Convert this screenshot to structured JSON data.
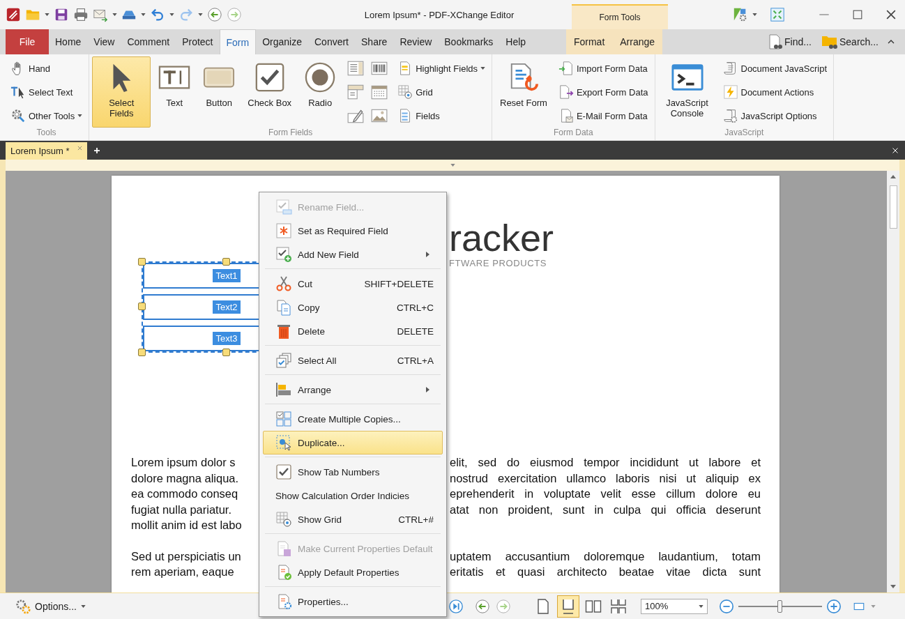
{
  "title_bar": {
    "title": "Lorem Ipsum* - PDF-XChange Editor",
    "context_group": "Form Tools"
  },
  "menu_tabs": [
    {
      "label": "File",
      "kind": "file",
      "selected": false
    },
    {
      "label": "Home",
      "kind": "tab",
      "selected": false
    },
    {
      "label": "View",
      "kind": "tab",
      "selected": false
    },
    {
      "label": "Comment",
      "kind": "tab",
      "selected": false
    },
    {
      "label": "Protect",
      "kind": "tab",
      "selected": false
    },
    {
      "label": "Form",
      "kind": "tab",
      "selected": true
    },
    {
      "label": "Organize",
      "kind": "tab",
      "selected": false
    },
    {
      "label": "Convert",
      "kind": "tab",
      "selected": false
    },
    {
      "label": "Share",
      "kind": "tab",
      "selected": false
    },
    {
      "label": "Review",
      "kind": "tab",
      "selected": false
    },
    {
      "label": "Bookmarks",
      "kind": "tab",
      "selected": false
    },
    {
      "label": "Help",
      "kind": "tab",
      "selected": false
    },
    {
      "label": "Format",
      "kind": "context",
      "selected": false
    },
    {
      "label": "Arrange",
      "kind": "context",
      "selected": false
    }
  ],
  "menu_actions": [
    {
      "label": "Find..."
    },
    {
      "label": "Search..."
    }
  ],
  "ribbon": {
    "groups": [
      {
        "label": "Tools",
        "columns": [
          {
            "kind": "stack",
            "items": [
              {
                "label": "Hand",
                "dropdown": false
              },
              {
                "label": "Select Text",
                "dropdown": false
              },
              {
                "label": "Other Tools",
                "dropdown": true
              }
            ]
          }
        ]
      },
      {
        "label": "Form Fields",
        "columns": [
          {
            "kind": "large",
            "label": "Select Fields",
            "selected": true
          },
          {
            "kind": "large",
            "label": "Text",
            "selected": false
          },
          {
            "kind": "large",
            "label": "Button",
            "selected": false
          },
          {
            "kind": "large",
            "label": "Check Box",
            "selected": false
          },
          {
            "kind": "large",
            "label": "Radio",
            "selected": false
          },
          {
            "kind": "icon_grid"
          },
          {
            "kind": "stack",
            "items": [
              {
                "label": "Highlight Fields",
                "dropdown": true
              },
              {
                "label": "Grid",
                "dropdown": false
              },
              {
                "label": "Fields",
                "dropdown": false
              }
            ]
          }
        ]
      },
      {
        "label": "Form Data",
        "columns": [
          {
            "kind": "large",
            "label": "Reset Form",
            "selected": false
          },
          {
            "kind": "stack",
            "items": [
              {
                "label": "Import Form Data",
                "dropdown": false
              },
              {
                "label": "Export Form Data",
                "dropdown": false
              },
              {
                "label": "E-Mail Form Data",
                "dropdown": false
              }
            ]
          }
        ]
      },
      {
        "label": "JavaScript",
        "columns": [
          {
            "kind": "large",
            "label": "JavaScript Console",
            "selected": false
          },
          {
            "kind": "stack",
            "items": [
              {
                "label": "Document JavaScript",
                "dropdown": false
              },
              {
                "label": "Document Actions",
                "dropdown": false
              },
              {
                "label": "JavaScript Options",
                "dropdown": false
              }
            ]
          }
        ]
      }
    ]
  },
  "document_tab": {
    "label": "Lorem Ipsum *",
    "selected": true
  },
  "document": {
    "logo": {
      "title": "racker",
      "subtitle": "FTWARE PRODUCTS"
    },
    "fields": [
      {
        "label": "Text1"
      },
      {
        "label": "Text2"
      },
      {
        "label": "Text3"
      }
    ],
    "paragraphs": [
      {
        "left_lines": [
          "Lorem ipsum dolor s",
          "dolore magna aliqua.",
          "ea commodo conseq",
          "fugiat nulla pariatur.",
          "mollit anim id est labo"
        ],
        "right_lines": [
          "elit, sed do eiusmod tempor incididunt ut labore et",
          "nostrud exercitation ullamco laboris nisi ut aliquip ex",
          "eprehenderit in voluptate velit esse cillum dolore eu",
          "atat non proident, sunt in culpa qui officia deserunt"
        ]
      },
      {
        "left_lines": [
          "Sed ut perspiciatis un",
          "rem aperiam, eaque"
        ],
        "right_lines": [
          "uptatem accusantium doloremque laudantium, totam",
          "eritatis et quasi architecto beatae vitae dicta sunt"
        ]
      }
    ]
  },
  "context_menu": [
    {
      "kind": "item",
      "label": "Rename Field...",
      "disabled": true,
      "selected": false,
      "submenu": false
    },
    {
      "kind": "item",
      "label": "Set as Required Field",
      "disabled": false,
      "selected": false,
      "submenu": false
    },
    {
      "kind": "item",
      "label": "Add New Field",
      "disabled": false,
      "selected": false,
      "submenu": true
    },
    {
      "kind": "separator"
    },
    {
      "kind": "item",
      "label": "Cut",
      "shortcut": "SHIFT+DELETE",
      "disabled": false,
      "selected": false,
      "submenu": false
    },
    {
      "kind": "item",
      "label": "Copy",
      "shortcut": "CTRL+C",
      "disabled": false,
      "selected": false,
      "submenu": false
    },
    {
      "kind": "item",
      "label": "Delete",
      "shortcut": "DELETE",
      "disabled": false,
      "selected": false,
      "submenu": false
    },
    {
      "kind": "separator"
    },
    {
      "kind": "item",
      "label": "Select All",
      "shortcut": "CTRL+A",
      "disabled": false,
      "selected": false,
      "submenu": false
    },
    {
      "kind": "separator"
    },
    {
      "kind": "item",
      "label": "Arrange",
      "disabled": false,
      "selected": false,
      "submenu": true
    },
    {
      "kind": "separator"
    },
    {
      "kind": "item",
      "label": "Create Multiple Copies...",
      "disabled": false,
      "selected": false,
      "submenu": false
    },
    {
      "kind": "item",
      "label": "Duplicate...",
      "disabled": false,
      "selected": true,
      "submenu": false
    },
    {
      "kind": "separator"
    },
    {
      "kind": "item",
      "label": "Show Tab Numbers",
      "disabled": false,
      "selected": false,
      "submenu": false
    },
    {
      "kind": "item",
      "label": "Show Calculation Order Indicies",
      "disabled": false,
      "selected": false,
      "submenu": false
    },
    {
      "kind": "item",
      "label": "Show Grid",
      "shortcut": "CTRL+#",
      "disabled": false,
      "selected": false,
      "submenu": false
    },
    {
      "kind": "separator"
    },
    {
      "kind": "item",
      "label": "Make Current Properties Default",
      "disabled": true,
      "selected": false,
      "submenu": false
    },
    {
      "kind": "item",
      "label": "Apply Default Properties",
      "disabled": false,
      "selected": false,
      "submenu": false
    },
    {
      "kind": "separator"
    },
    {
      "kind": "item",
      "label": "Properties...",
      "disabled": false,
      "selected": false,
      "submenu": false
    }
  ],
  "status_bar": {
    "options": {
      "label": "Options..."
    },
    "view_modes": [
      {
        "selected": false
      },
      {
        "selected": true
      },
      {
        "selected": false
      },
      {
        "selected": false
      }
    ],
    "zoom": {
      "value": "100%"
    },
    "zoom_slider": {
      "level": 0.5
    }
  }
}
